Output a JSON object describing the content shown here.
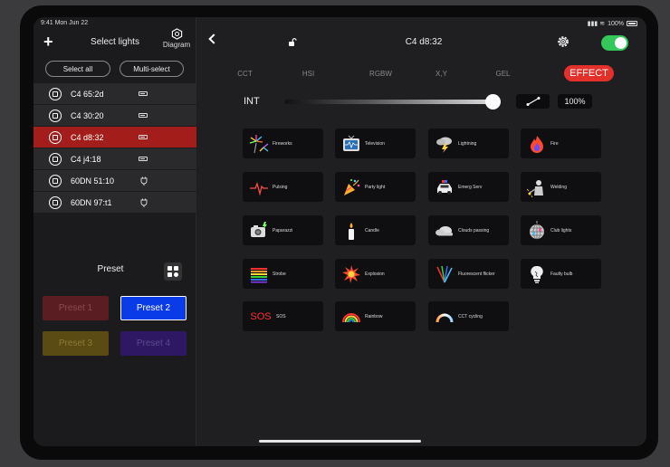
{
  "status": {
    "time": "9:41  Mon Jun 22",
    "battery": "100%"
  },
  "left_panel": {
    "add_label": "+",
    "title": "Select lights",
    "diagram_label": "Diagram",
    "select_all": "Select all",
    "multi_select": "Multi-select",
    "lights": [
      {
        "name": "C4 65:2d",
        "power": "battery",
        "selected": false
      },
      {
        "name": "C4 30:20",
        "power": "battery",
        "selected": false
      },
      {
        "name": "C4 d8:32",
        "power": "battery",
        "selected": true
      },
      {
        "name": "C4 j4:18",
        "power": "battery",
        "selected": false
      },
      {
        "name": "60DN 51:10",
        "power": "plug",
        "selected": false
      },
      {
        "name": "60DN 97:t1",
        "power": "plug",
        "selected": false
      }
    ],
    "preset_title": "Preset",
    "presets": [
      "Preset 1",
      "Preset 2",
      "Preset 3",
      "Preset 4"
    ]
  },
  "right_panel": {
    "device_title": "C4 d8:32",
    "power_on": true,
    "tabs": [
      "CCT",
      "HSI",
      "RGBW",
      "X,Y",
      "GEL",
      "EFFECT"
    ],
    "active_tab": "EFFECT",
    "intensity_label": "INT",
    "intensity_value": "100%",
    "intensity_fraction": 1.0,
    "effects": [
      {
        "label": "Fireworks",
        "icon": "fireworks-icon"
      },
      {
        "label": "Television",
        "icon": "television-icon"
      },
      {
        "label": "Lightning",
        "icon": "lightning-icon"
      },
      {
        "label": "Fire",
        "icon": "fire-icon"
      },
      {
        "label": "Pulsing",
        "icon": "pulsing-icon"
      },
      {
        "label": "Party light",
        "icon": "party-icon"
      },
      {
        "label": "Emerg Serv",
        "icon": "police-car-icon"
      },
      {
        "label": "Welding",
        "icon": "welding-icon"
      },
      {
        "label": "Paparazzi",
        "icon": "camera-icon"
      },
      {
        "label": "Candle",
        "icon": "candle-icon"
      },
      {
        "label": "Clouds passing",
        "icon": "cloud-icon"
      },
      {
        "label": "Club lights",
        "icon": "disco-ball-icon"
      },
      {
        "label": "Strobe",
        "icon": "strobe-icon"
      },
      {
        "label": "Explosion",
        "icon": "explosion-icon"
      },
      {
        "label": "Fluorescent flicker",
        "icon": "fluorescent-icon"
      },
      {
        "label": "Faulty bulb",
        "icon": "bulb-icon"
      },
      {
        "label": "SOS",
        "icon": "sos-icon",
        "icon_text": "SOS"
      },
      {
        "label": "Rainbow",
        "icon": "rainbow-icon"
      },
      {
        "label": "CCT cycling",
        "icon": "cct-arc-icon"
      }
    ]
  },
  "colors": {
    "accent_red": "#e3302a",
    "selected_row": "#a31d1b",
    "preset_active": "#0a3be8",
    "toggle_on": "#34c759"
  }
}
